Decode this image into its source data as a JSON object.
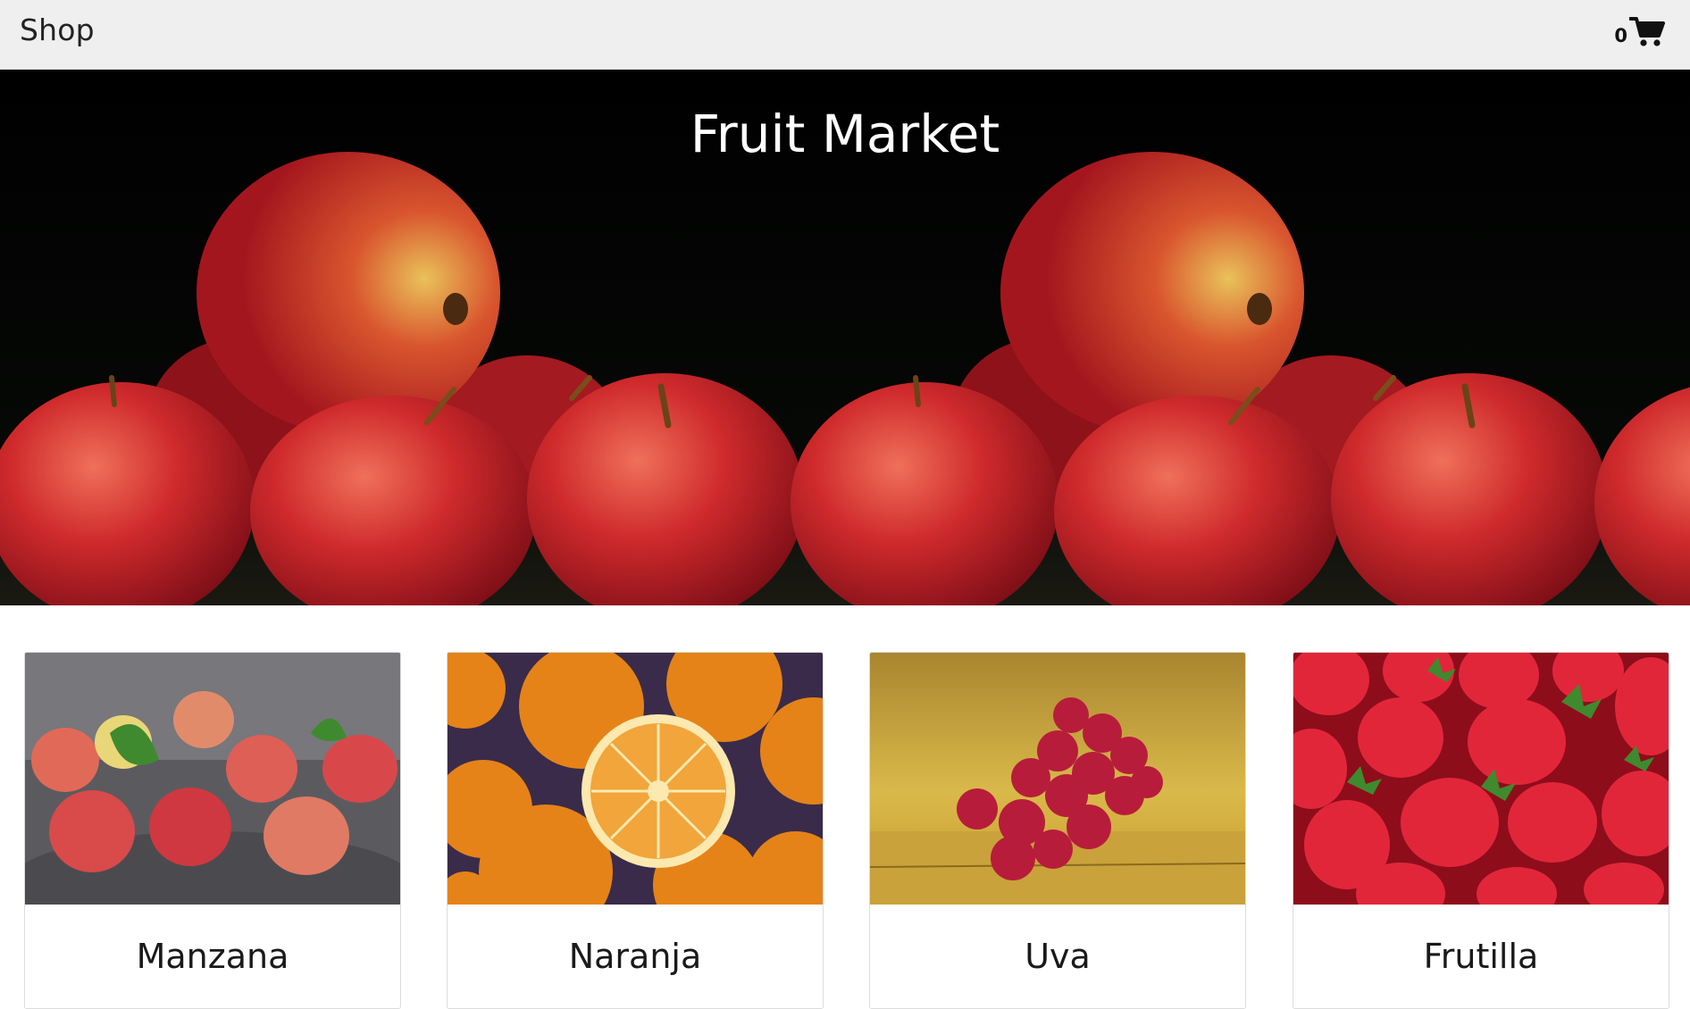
{
  "navbar": {
    "brand": "Shop",
    "cart_count": "0",
    "cart_icon": "shopping-cart-icon"
  },
  "hero": {
    "title": "Fruit Market",
    "image": "red-apples-on-black-background"
  },
  "products": [
    {
      "name": "Manzana",
      "image": "apples-photo"
    },
    {
      "name": "Naranja",
      "image": "oranges-photo"
    },
    {
      "name": "Uva",
      "image": "grapes-photo"
    },
    {
      "name": "Frutilla",
      "image": "strawberries-photo"
    }
  ],
  "colors": {
    "navbar_bg": "#efefef",
    "hero_bg": "#000000",
    "apple_red": "#c41f2c"
  }
}
